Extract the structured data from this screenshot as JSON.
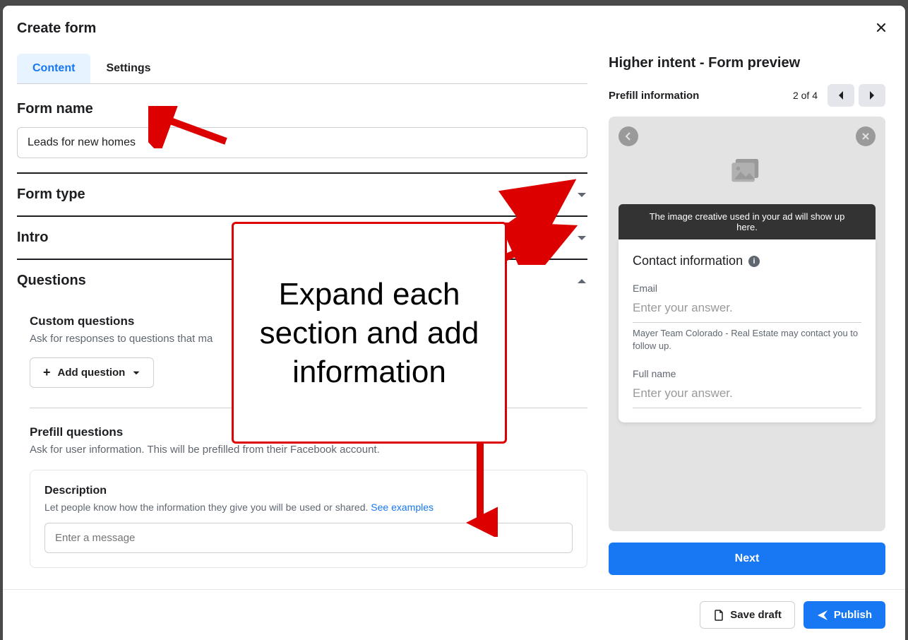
{
  "modal": {
    "title": "Create form"
  },
  "tabs": {
    "content": "Content",
    "settings": "Settings"
  },
  "form_name": {
    "label": "Form name",
    "value": "Leads for new homes"
  },
  "sections": {
    "form_type": "Form type",
    "intro": "Intro",
    "questions": "Questions"
  },
  "custom_questions": {
    "title": "Custom questions",
    "desc": "Ask for responses to questions that ma",
    "add_button": "Add question"
  },
  "prefill": {
    "title": "Prefill questions",
    "desc": "Ask for user information. This will be prefilled from their Facebook account.",
    "description_label": "Description",
    "description_help": "Let people know how the information they give you will be used or shared. ",
    "see_examples": "See examples",
    "placeholder": "Enter a message"
  },
  "preview": {
    "title": "Higher intent - Form preview",
    "section_label": "Prefill information",
    "page_info": "2 of 4",
    "image_banner": "The image creative used in your ad will show up here.",
    "card_title": "Contact information",
    "email_label": "Email",
    "email_placeholder": "Enter your answer.",
    "email_note": "Mayer Team Colorado - Real Estate may contact you to follow up.",
    "name_label": "Full name",
    "name_placeholder": "Enter your answer.",
    "next_button": "Next"
  },
  "footer": {
    "save_draft": "Save draft",
    "publish": "Publish"
  },
  "annotation": {
    "text": "Expand each section and add information"
  }
}
